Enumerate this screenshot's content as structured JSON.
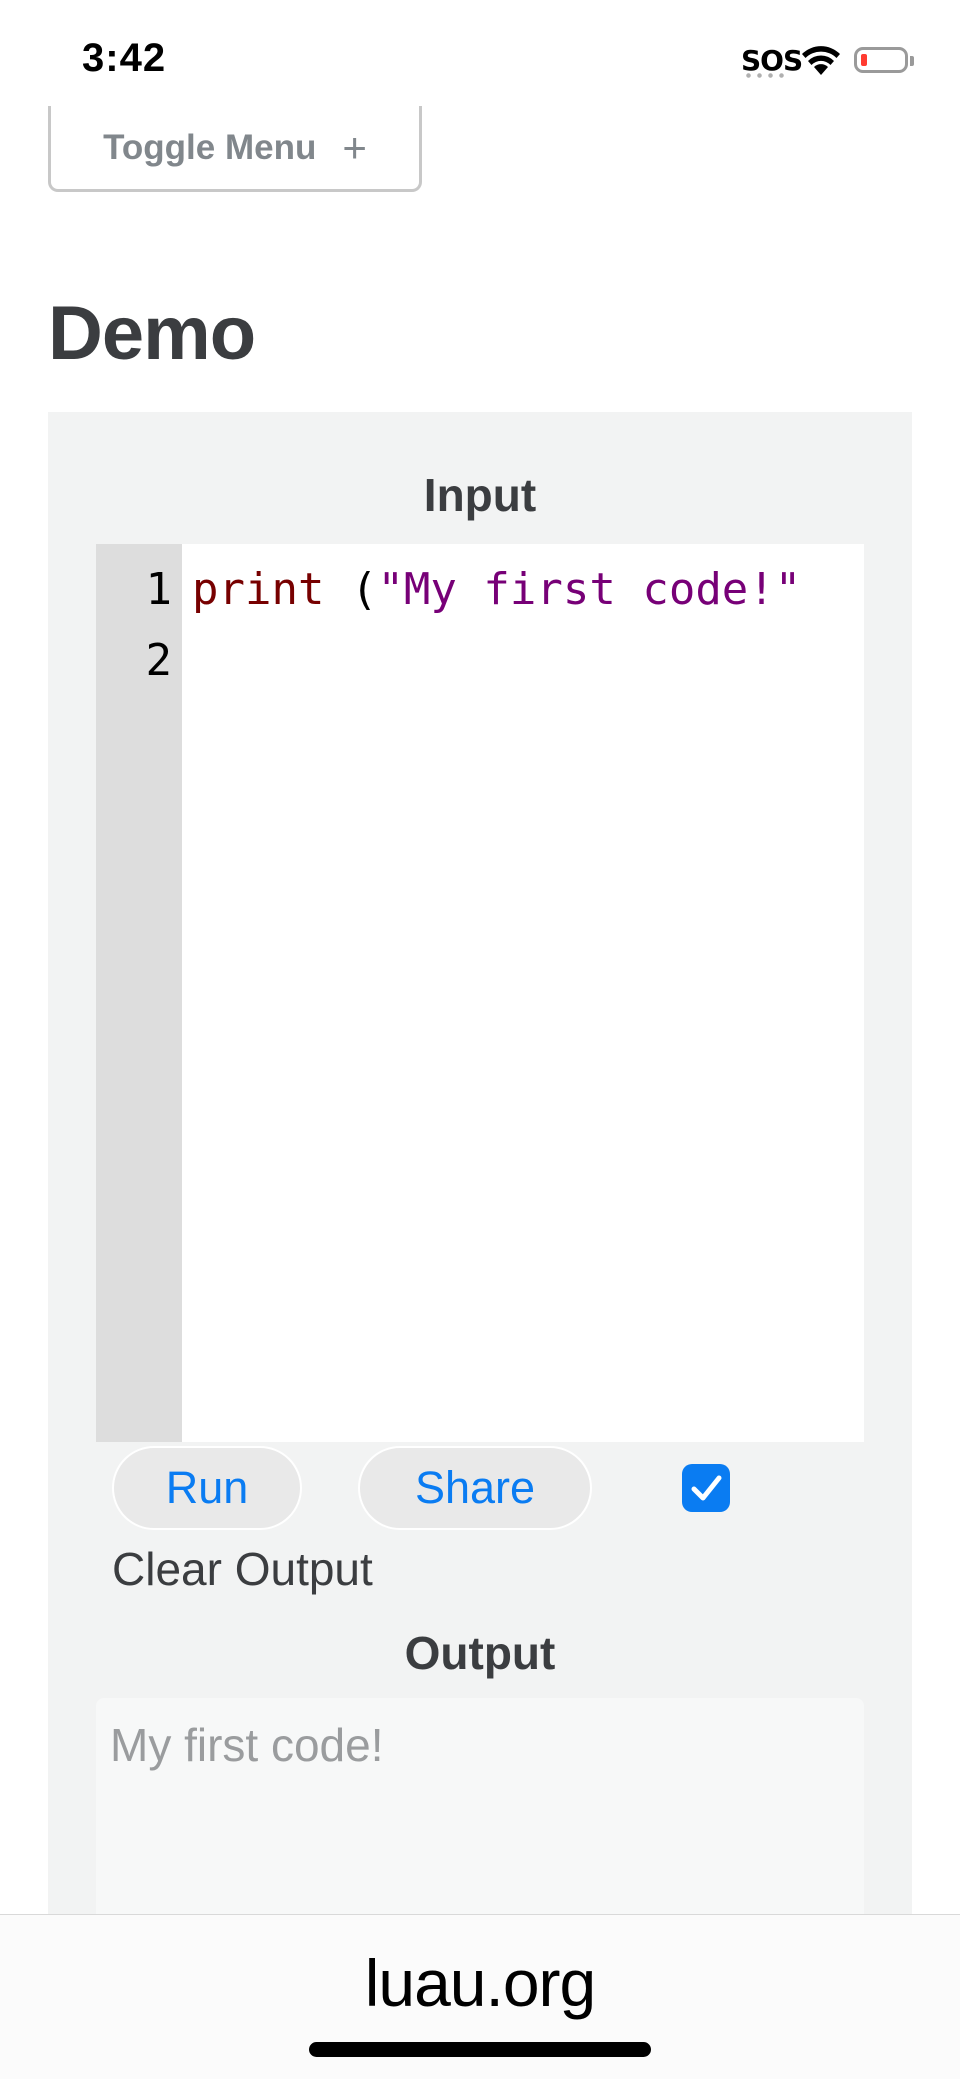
{
  "status_bar": {
    "time": "3:42",
    "sos": "SOS",
    "wifi_icon": "wifi-icon",
    "battery_icon": "battery-low-icon",
    "battery_color": "#ff3b30"
  },
  "toggle_menu": {
    "label": "Toggle Menu",
    "plus": "+"
  },
  "demo": {
    "title": "Demo",
    "input_label": "Input",
    "editor": {
      "line_numbers": [
        "1",
        "2"
      ],
      "lines": [
        {
          "keyword": "print",
          "rest": " (",
          "string": "\"My first code!\""
        },
        {
          "keyword": "",
          "rest": "",
          "string": ""
        }
      ]
    },
    "run_label": "Run",
    "share_label": "Share",
    "checkbox_checked": true,
    "clear_output_label": "Clear Output",
    "output_label": "Output",
    "output_text": "My first code!"
  },
  "browser": {
    "domain": "luau.org"
  },
  "colors": {
    "accent": "#0a7cf2",
    "keyword": "#770000",
    "string": "#770077",
    "heading": "#3b3d40"
  }
}
